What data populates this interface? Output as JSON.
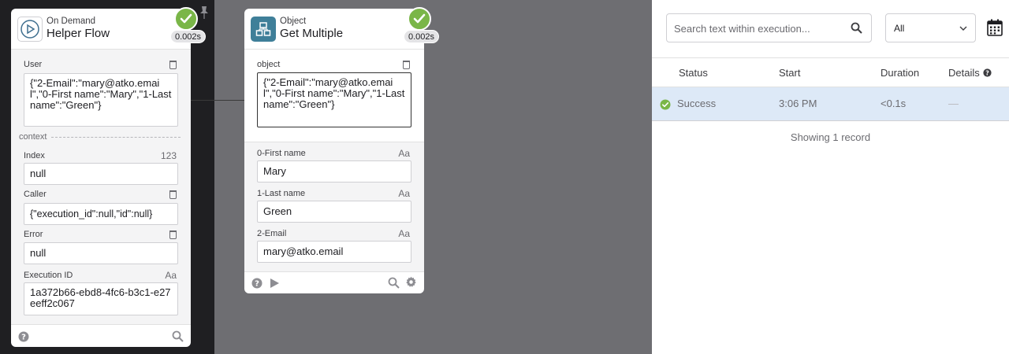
{
  "left_card": {
    "subtitle": "On Demand",
    "title": "Helper Flow",
    "time": "0.002s",
    "user_label": "User",
    "user_value": "{\"2-Email\":\"mary@atko.email\",\"0-First name\":\"Mary\",\"1-Last name\":\"Green\"}",
    "context_label": "context",
    "index_label": "Index",
    "index_tag": "123",
    "index_value": "null",
    "caller_label": "Caller",
    "caller_value": "{\"execution_id\":null,\"id\":null}",
    "error_label": "Error",
    "error_value": "null",
    "execution_id_label": "Execution ID",
    "execution_id_tag": "Aa",
    "execution_id_value": "1a372b66-ebd8-4fc6-b3c1-e27eeff2c067"
  },
  "mid_card": {
    "subtitle": "Object",
    "title": "Get Multiple",
    "time": "0.002s",
    "object_label": "object",
    "object_value": "{\"2-Email\":\"mary@atko.email\",\"0-First name\":\"Mary\",\"1-Last name\":\"Green\"}",
    "outputs": [
      {
        "label": "0-First name",
        "tag": "Aa",
        "value": "Mary"
      },
      {
        "label": "1-Last name",
        "tag": "Aa",
        "value": "Green"
      },
      {
        "label": "2-Email",
        "tag": "Aa",
        "value": "mary@atko.email"
      }
    ]
  },
  "panel": {
    "search_placeholder": "Search text within execution...",
    "filter_value": "All",
    "columns": {
      "status": "Status",
      "start": "Start",
      "duration": "Duration",
      "details": "Details"
    },
    "row": {
      "status": "Success",
      "start": "3:06 PM",
      "duration": "<0.1s",
      "details": "—"
    },
    "showing": "Showing 1 record"
  },
  "colors": {
    "success": "#7ab648",
    "accent_icon": "#3f7f99",
    "row_highlight": "#dde9f7"
  }
}
